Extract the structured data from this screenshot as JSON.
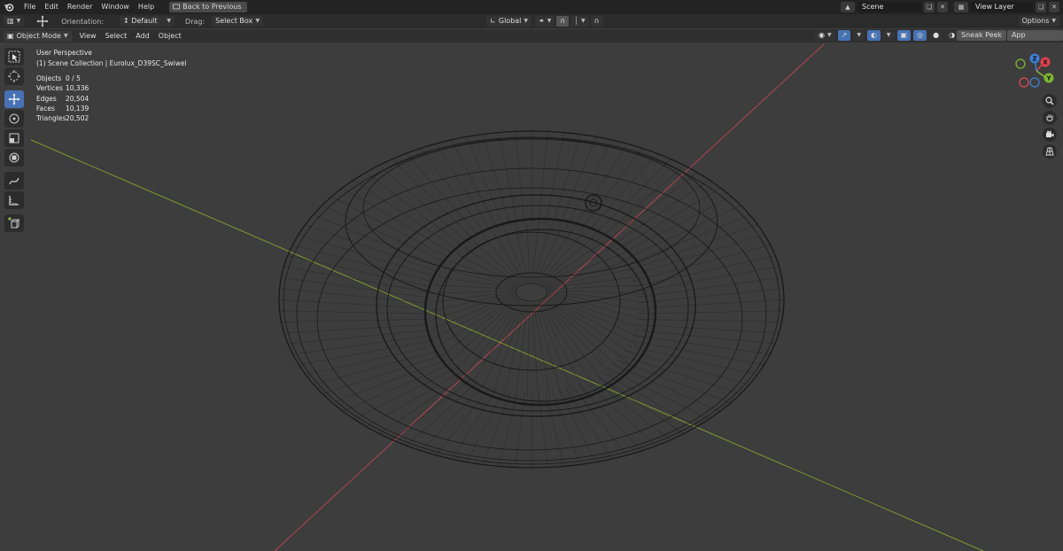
{
  "menubar": {
    "items": [
      "File",
      "Edit",
      "Render",
      "Window",
      "Help"
    ],
    "back_button": "Back to Previous",
    "scene_value": "Scene",
    "view_layer_value": "View Layer"
  },
  "toolsettings": {
    "orientation_label": "Orientation:",
    "orientation_value": "Default",
    "drag_label": "Drag:",
    "drag_value": "Select Box",
    "transform_orientation": "Global",
    "options_label": "Options"
  },
  "viewport_header": {
    "mode": "Object Mode",
    "menus": [
      "View",
      "Select",
      "Add",
      "Object"
    ],
    "sneak_peek": "Sneak Peek",
    "app_manager": "App Manager"
  },
  "viewport": {
    "perspective": "User Perspective",
    "collection": "(1) Scene Collection | Eurolux_D39SC_Swiwel",
    "stats": [
      {
        "label": "Objects",
        "value": "0 / 5"
      },
      {
        "label": "Vertices",
        "value": "10,336"
      },
      {
        "label": "Edges",
        "value": "20,504"
      },
      {
        "label": "Faces",
        "value": "10,139"
      },
      {
        "label": "Triangles",
        "value": "20,502"
      }
    ]
  },
  "gizmo": {
    "x_label": "X",
    "y_label": "Y",
    "z_label": "Z",
    "x_color": "#e0434f",
    "y_color": "#7fb733",
    "z_color": "#3f7fd8"
  },
  "colors": {
    "accent": "#4772b3",
    "x_axis_line": "#b24750",
    "y_axis_line": "#7d9a30"
  },
  "icons": {
    "tools": [
      "select-box-icon",
      "cursor-icon",
      "move-icon",
      "rotate-icon",
      "scale-icon",
      "transform-icon",
      "annotate-icon",
      "measure-icon",
      "add-cube-icon"
    ],
    "nav": [
      "zoom-icon",
      "hand-pan-icon",
      "camera-icon",
      "grid-perspective-icon"
    ]
  }
}
